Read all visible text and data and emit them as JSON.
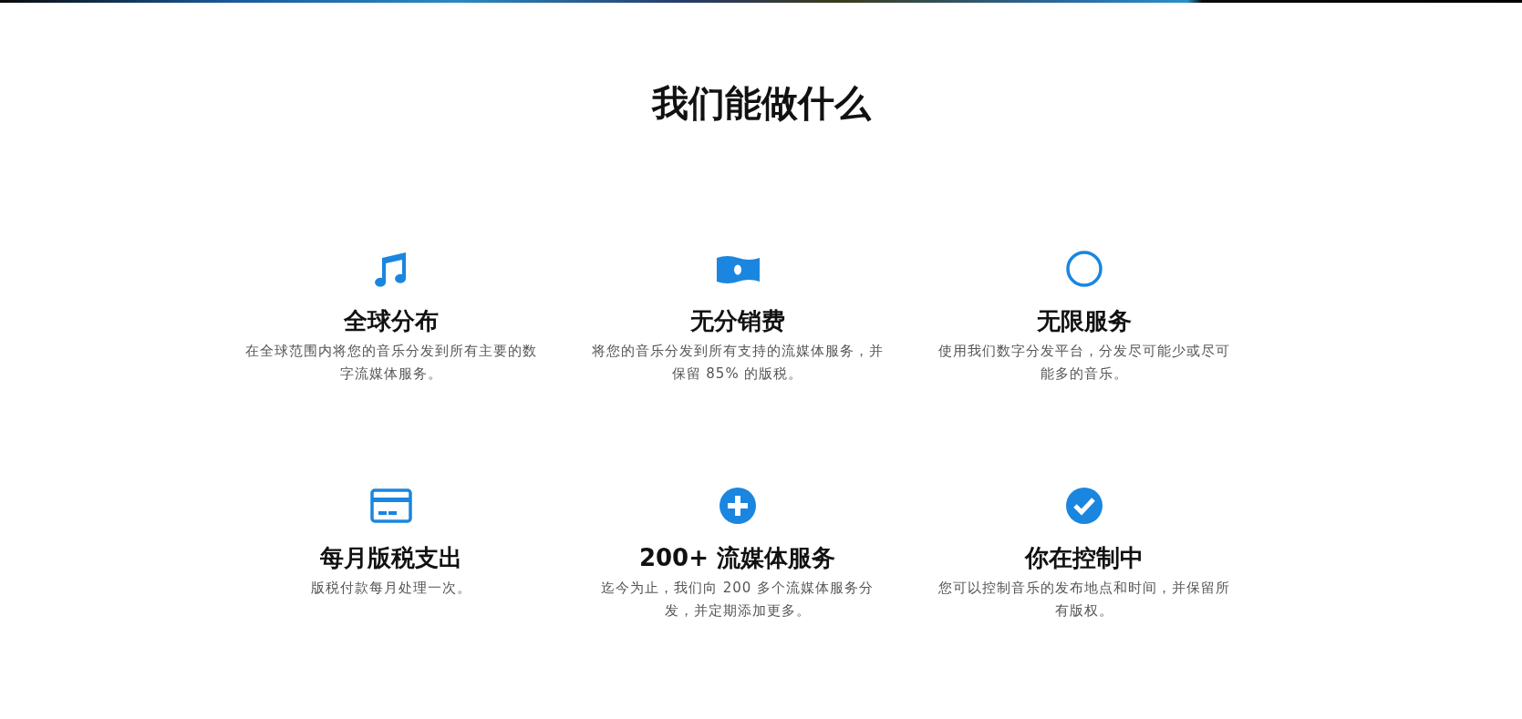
{
  "title": "我们能做什么",
  "features": [
    {
      "kind": "music",
      "heading": "全球分布",
      "description": "在全球范围内将您的音乐分发到所有主要的数字流媒体服务。"
    },
    {
      "kind": "money",
      "heading": "无分销费",
      "description": "将您的音乐分发到所有支持的流媒体服务，并保留 85% 的版税。"
    },
    {
      "kind": "ring",
      "heading": "无限服务",
      "description": "使用我们数字分发平台，分发尽可能少或尽可能多的音乐。"
    },
    {
      "kind": "card",
      "heading": "每月版税支出",
      "description": "版税付款每月处理一次。"
    },
    {
      "kind": "plus",
      "heading": "200+ 流媒体服务",
      "description": "迄今为止，我们向 200 多个流媒体服务分发，并定期添加更多。"
    },
    {
      "kind": "check",
      "heading": "你在控制中",
      "description": "您可以控制音乐的发布地点和时间，并保留所有版权。"
    }
  ]
}
